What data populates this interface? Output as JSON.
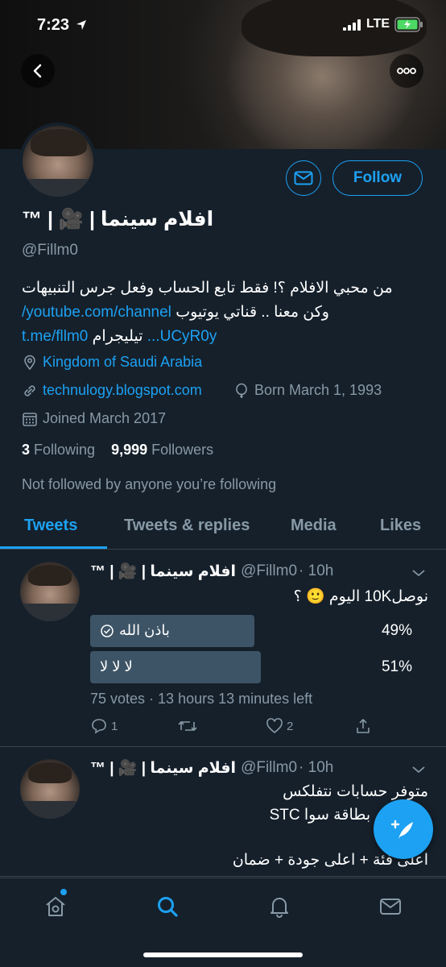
{
  "status_bar": {
    "time": "7:23",
    "network": "LTE"
  },
  "profile": {
    "display_name": "افلام سينما | 🎥 | ™",
    "handle": "@Fillm0",
    "bio_line1": "من محبي الافلام ؟! فقط تابع الحساب وفعل جرس التنبيهات",
    "bio_line2_text": "وكن معنا .. قناتي يوتيوب",
    "bio_line2_link": "youtube.com/channel/",
    "bio_line3_text": "تيليجرام",
    "bio_line3_link_a": "UCyR0y...",
    "bio_line3_link_b": "t.me/fllm0",
    "location": "Kingdom of Saudi Arabia",
    "website": "technulogy.blogspot.com",
    "born": "Born March 1, 1993",
    "joined": "Joined March 2017",
    "following_count": "3",
    "following_label": "Following",
    "followers_count": "9,999",
    "followers_label": "Followers",
    "not_followed": "Not followed by anyone you’re following",
    "follow_label": "Follow"
  },
  "tabs": [
    {
      "label": "Tweets",
      "active": true
    },
    {
      "label": "Tweets & replies",
      "active": false
    },
    {
      "label": "Media",
      "active": false
    },
    {
      "label": "Likes",
      "active": false
    }
  ],
  "tweets": [
    {
      "name": "افلام سينما | 🎥 | ™",
      "handle": "@Fillm0",
      "time": "· 10h",
      "text": "نوصل10K  اليوم 🙂 ؟",
      "poll": [
        {
          "label": "باذن الله",
          "percent_text": "49%",
          "percent": 49,
          "selected": true
        },
        {
          "label": "لا لا لا",
          "percent_text": "51%",
          "percent": 51,
          "selected": false
        }
      ],
      "poll_meta": "75 votes · 13 hours 13 minutes left",
      "replies": "1",
      "retweets": "",
      "likes": "2"
    },
    {
      "name": "افلام سينما | 🎥 | ™",
      "handle": "@Fillm0",
      "time": "· 10h",
      "line1": "متوفر حسابات نتفلكس",
      "line2": "بالإرسال بطاقة سوا STC",
      "line3": "اعلى فئة + اعلى جودة + ضمان"
    }
  ],
  "colors": {
    "accent": "#1da1f2",
    "background": "#15202b",
    "muted": "#8899a6",
    "poll_bar": "#3d5466"
  }
}
